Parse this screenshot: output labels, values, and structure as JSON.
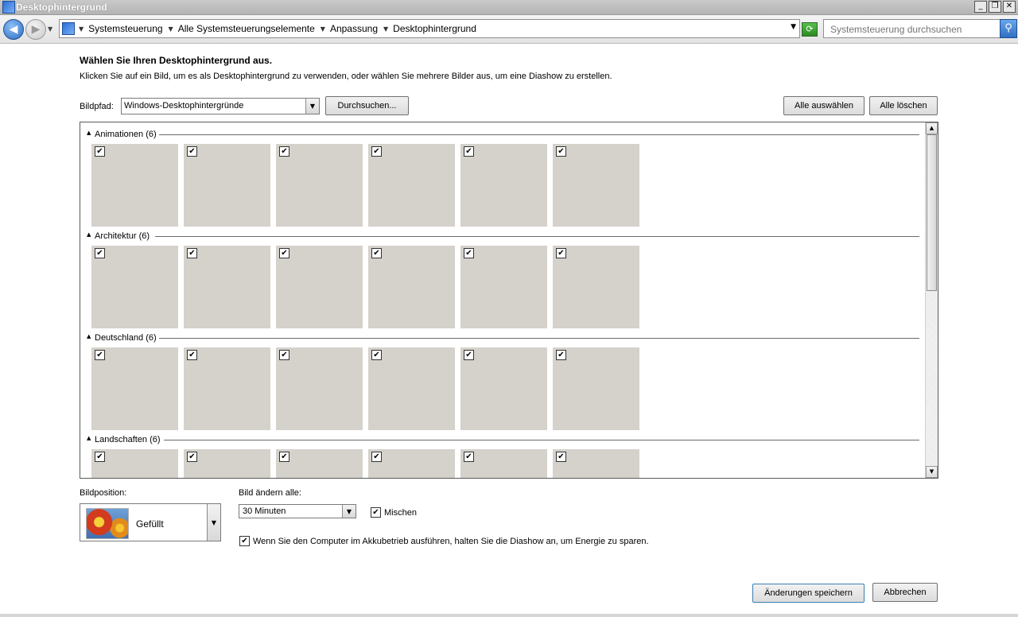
{
  "window": {
    "title": "Desktophintergrund",
    "controls": {
      "minimize": "_",
      "restore": "❐",
      "close": "✕"
    }
  },
  "address_bar": {
    "crumbs": [
      "Systemsteuerung",
      "Alle Systemsteuerungselemente",
      "Anpassung",
      "Desktophintergrund"
    ],
    "search_placeholder": "Systemsteuerung durchsuchen",
    "icons": {
      "back": "back-arrow-icon",
      "forward": "forward-arrow-icon",
      "refresh": "refresh-icon",
      "search": "magnifier-icon"
    }
  },
  "header": {
    "title": "Wählen Sie Ihren Desktophintergrund aus.",
    "subtitle": "Klicken Sie auf ein Bild, um es als Desktophintergrund zu verwenden, oder wählen Sie mehrere Bilder aus, um eine Diashow zu erstellen."
  },
  "path": {
    "label": "Bildpfad:",
    "value": "Windows-Desktophintergründe",
    "browse_label": "Durchsuchen...",
    "select_all_label": "Alle auswählen",
    "clear_all_label": "Alle löschen"
  },
  "gallery": {
    "groups": [
      {
        "title": "Animationen (6)",
        "thumbs": 6,
        "checked": true
      },
      {
        "title": "Architektur (6)",
        "thumbs": 6,
        "checked": true
      },
      {
        "title": "Deutschland (6)",
        "thumbs": 6,
        "checked": true
      },
      {
        "title": "Landschaften (6)",
        "thumbs": 6,
        "checked": true
      }
    ],
    "thumb_color": "#d5d1cb"
  },
  "position": {
    "label": "Bildposition:",
    "value": "Gefüllt"
  },
  "interval": {
    "label": "Bild ändern alle:",
    "value": "30 Minuten",
    "shuffle_label": "Mischen",
    "shuffle_checked": true,
    "battery_label": "Wenn Sie den Computer im Akkubetrieb ausführen, halten Sie die Diashow an, um Energie zu sparen.",
    "battery_checked": true
  },
  "footer": {
    "save_label": "Änderungen speichern",
    "cancel_label": "Abbrechen"
  }
}
